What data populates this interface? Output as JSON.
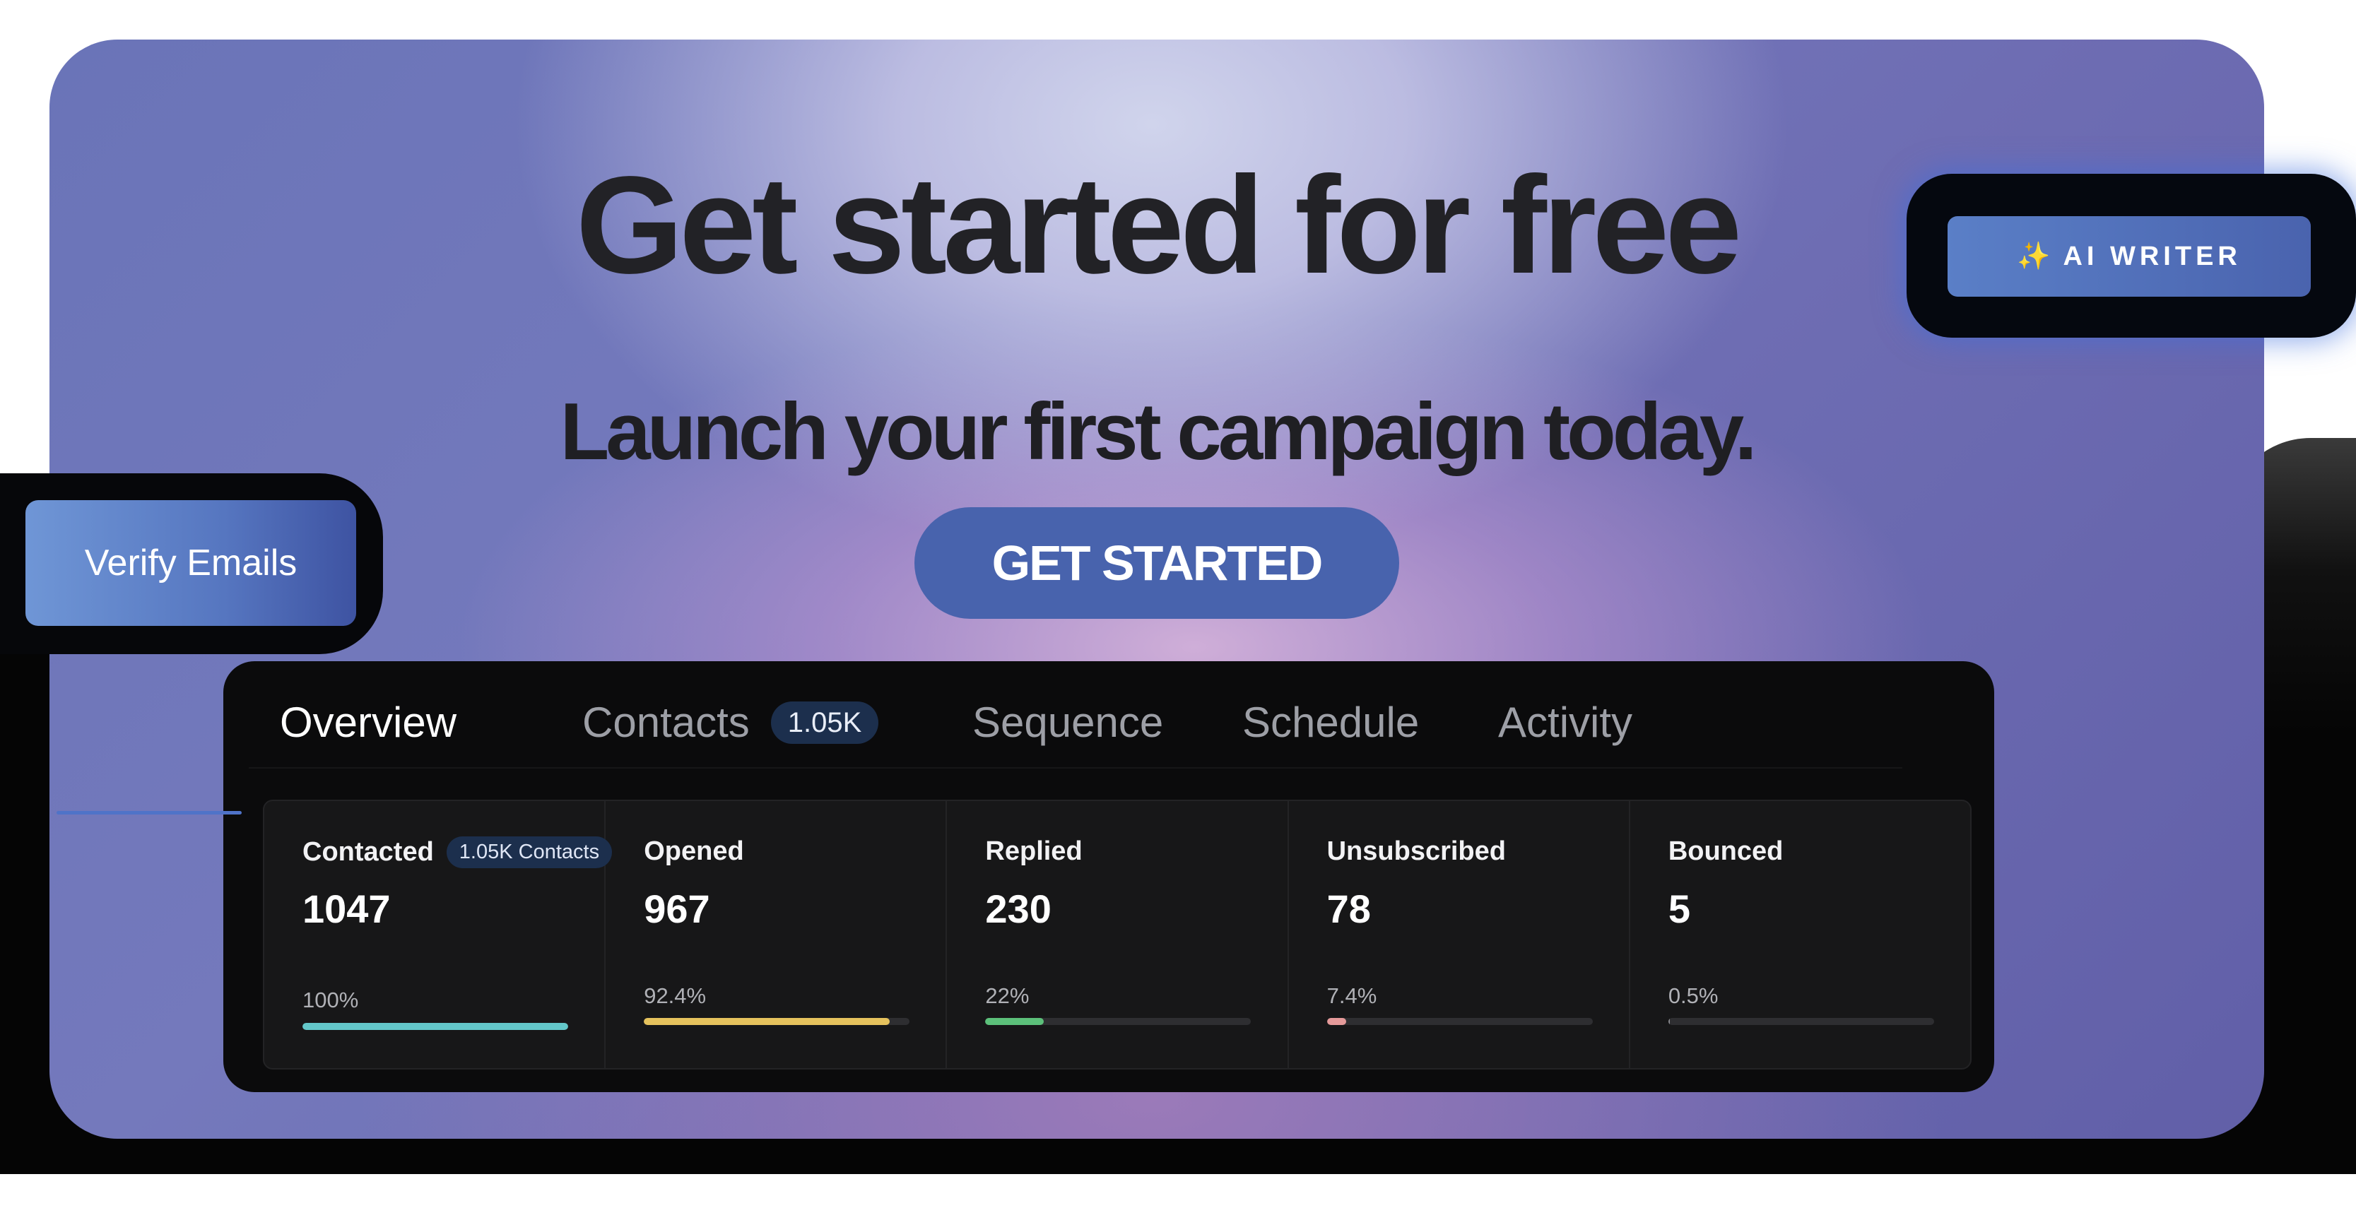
{
  "hero": {
    "headline": "Get started for free",
    "subline": "Launch your first campaign today.",
    "cta_label": "GET STARTED"
  },
  "floating": {
    "ai_writer_label": "AI WRITER",
    "ai_writer_icon": "sparkle-icon",
    "verify_label": "Verify Emails"
  },
  "tabs": [
    {
      "label": "Overview",
      "active": true
    },
    {
      "label": "Contacts",
      "badge": "1.05K"
    },
    {
      "label": "Sequence"
    },
    {
      "label": "Schedule"
    },
    {
      "label": "Activity"
    }
  ],
  "stats": [
    {
      "label": "Contacted",
      "badge": "1.05K Contacts",
      "value": "1047",
      "pct": "100%",
      "fill": 1.0,
      "color": "#63c7c9"
    },
    {
      "label": "Opened",
      "value": "967",
      "pct": "92.4%",
      "fill": 0.924,
      "color": "#e5c25d"
    },
    {
      "label": "Replied",
      "value": "230",
      "pct": "22%",
      "fill": 0.22,
      "color": "#5cc07a"
    },
    {
      "label": "Unsubscribed",
      "value": "78",
      "pct": "7.4%",
      "fill": 0.074,
      "color": "#e59a9a"
    },
    {
      "label": "Bounced",
      "value": "5",
      "pct": "0.5%",
      "fill": 0.005,
      "color": "#8a8a8f"
    }
  ],
  "colors": {
    "accent": "#4863ad",
    "tab_underline": "#4f73c8"
  }
}
